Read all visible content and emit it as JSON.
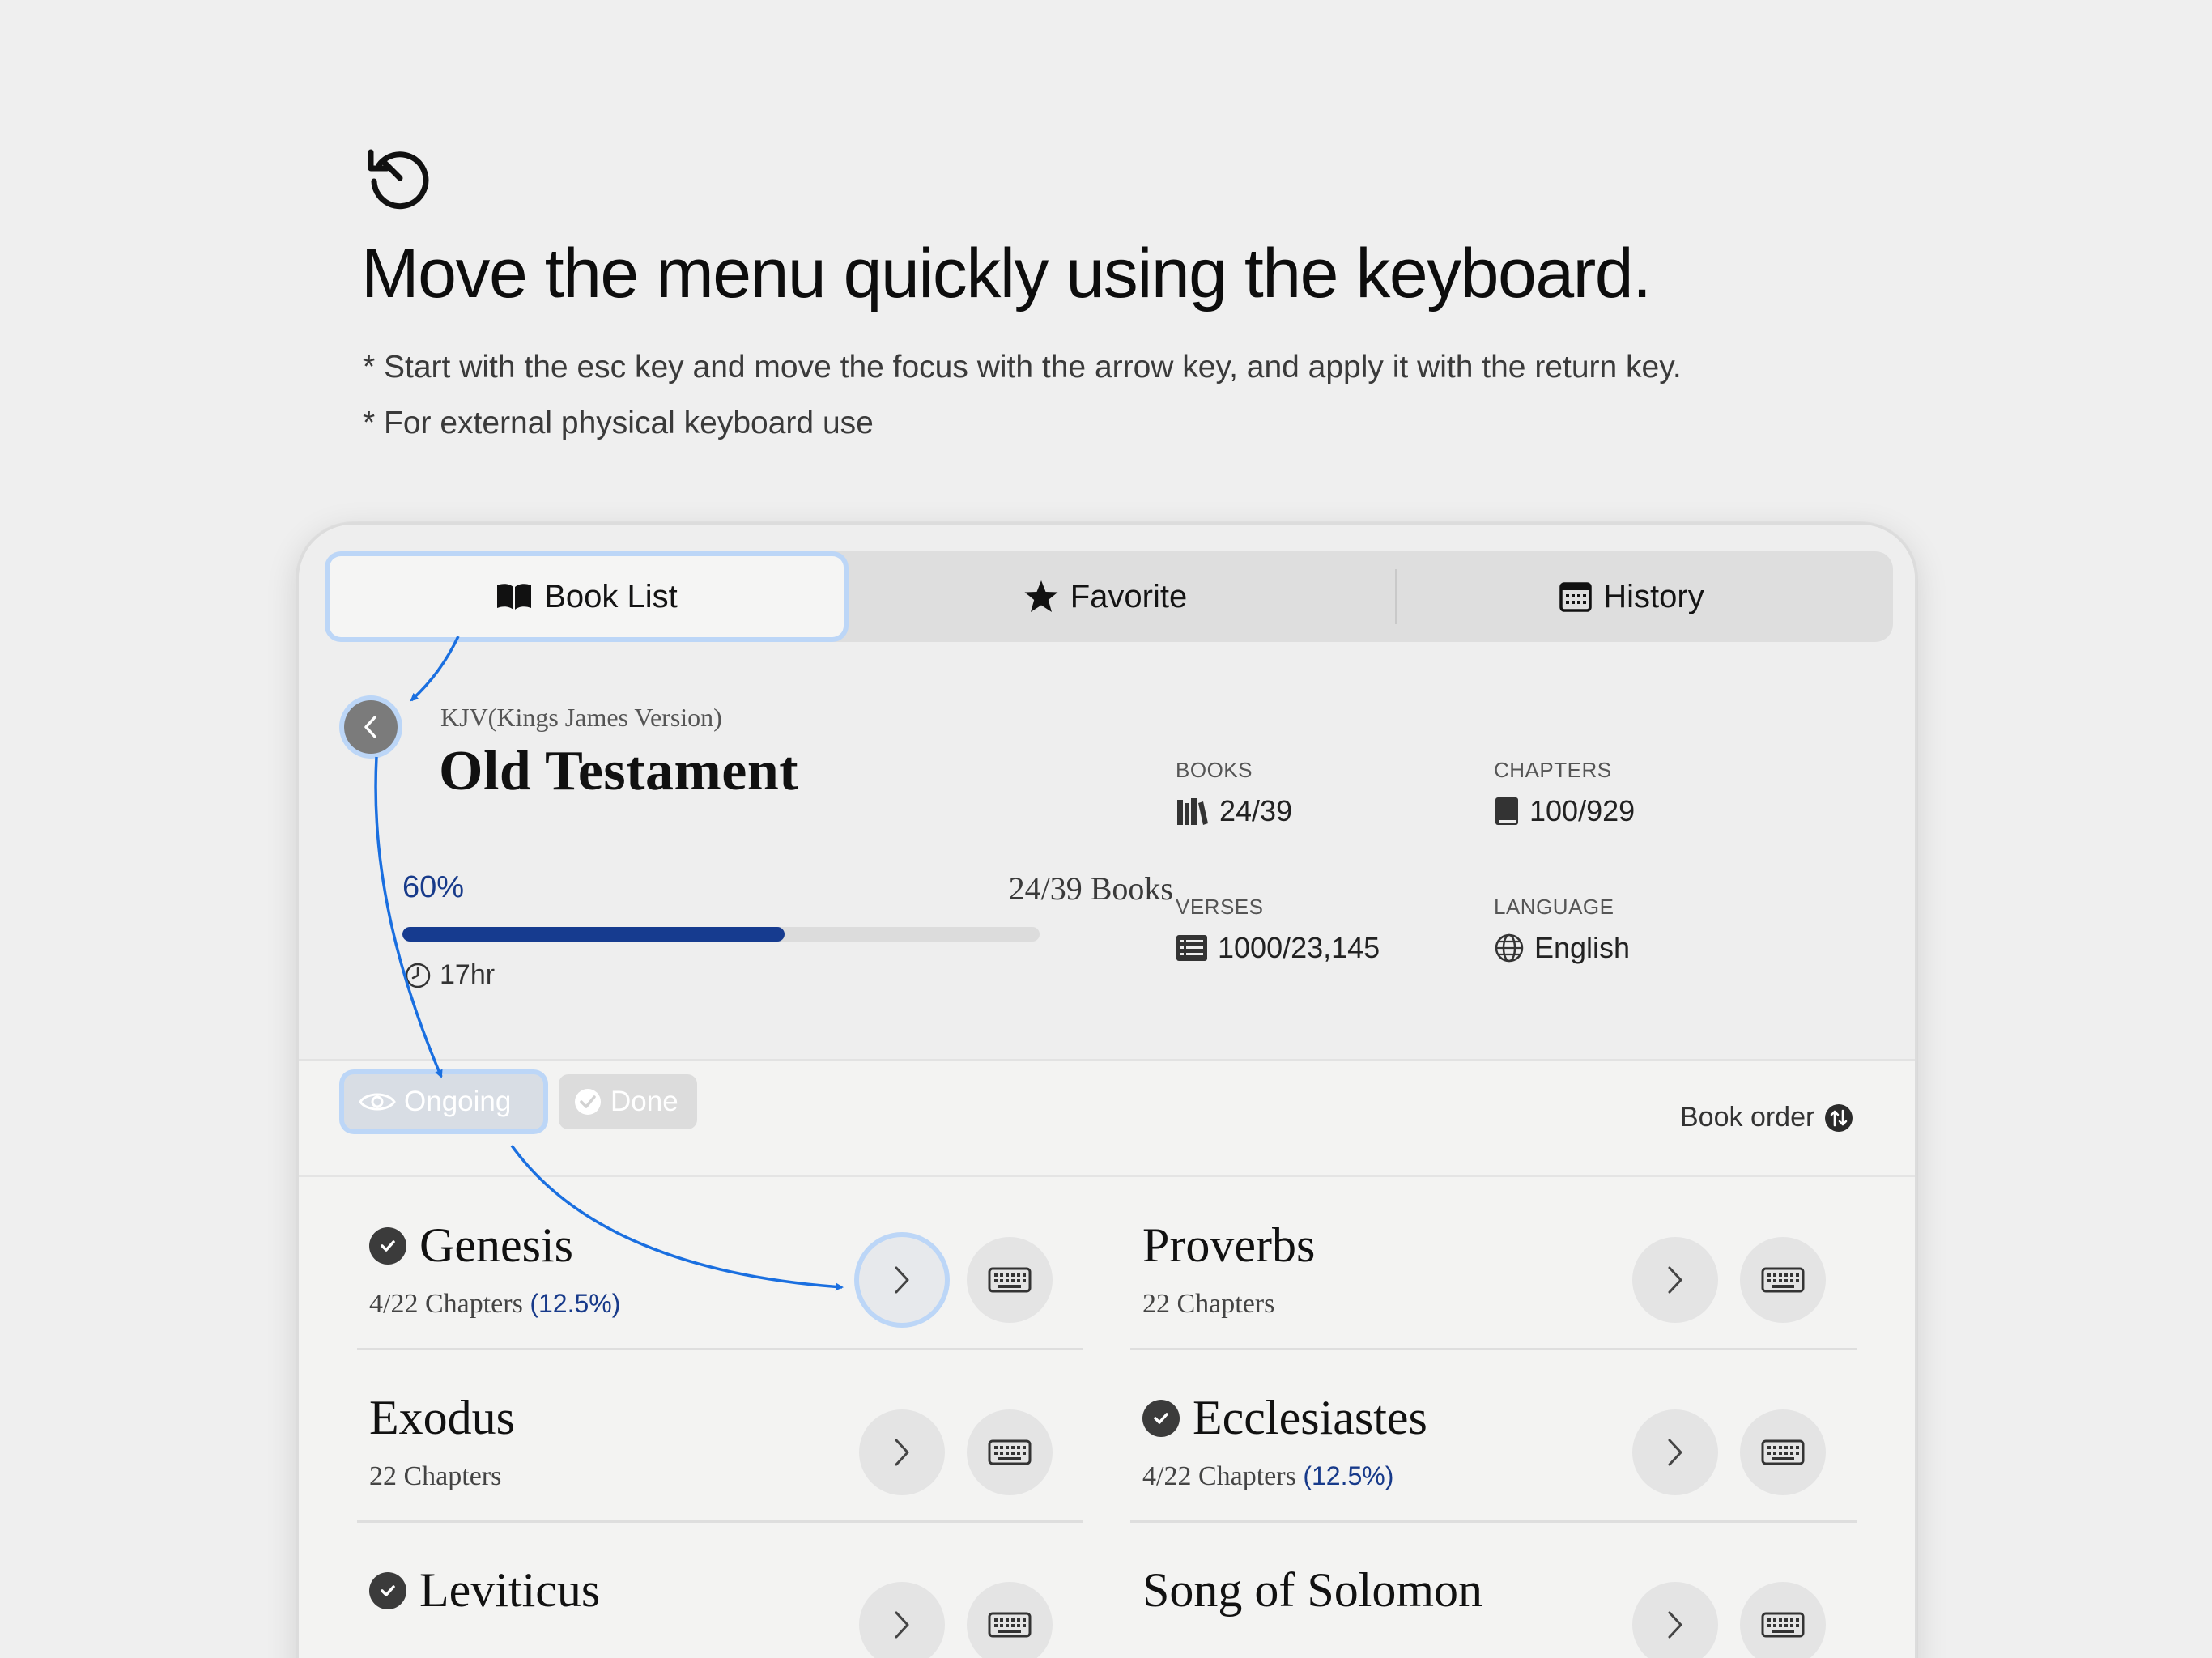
{
  "header": {
    "icon": "history-rotate-icon",
    "headline": "Move the menu quickly using the keyboard.",
    "note1": "* Start with the esc key and move the focus with the arrow key, and apply it with the return key.",
    "note2": "* For external physical keyboard use"
  },
  "tabs": [
    {
      "label": "Book List",
      "icon": "open-book-icon",
      "selected": true
    },
    {
      "label": "Favorite",
      "icon": "star-icon"
    },
    {
      "label": "History",
      "icon": "calendar-icon"
    }
  ],
  "testament": {
    "version": "KJV(Kings James Version)",
    "title": "Old Testament",
    "progress_label": "60%",
    "progress": 0.6,
    "books_progress": "24/39 Books",
    "time": "17hr"
  },
  "stats": {
    "books": {
      "label": "BOOKS",
      "value": "24/39"
    },
    "chapters": {
      "label": "CHAPTERS",
      "value": "100/929"
    },
    "verses": {
      "label": "VERSES",
      "value": "1000/23,145"
    },
    "language": {
      "label": "LANGUAGE",
      "value": "English"
    }
  },
  "filters": {
    "ongoing": "Ongoing",
    "done": "Done",
    "sort": "Book order"
  },
  "books": [
    {
      "name": "Genesis",
      "done": true,
      "chapters": "4/22 Chapters",
      "percent": "(12.5%)"
    },
    {
      "name": "Proverbs",
      "done": false,
      "chapters": "22 Chapters",
      "percent": ""
    },
    {
      "name": "Exodus",
      "done": false,
      "chapters": "22 Chapters",
      "percent": ""
    },
    {
      "name": "Ecclesiastes",
      "done": true,
      "chapters": "4/22 Chapters",
      "percent": "(12.5%)"
    },
    {
      "name": "Leviticus",
      "done": true,
      "chapters": "",
      "percent": ""
    },
    {
      "name": "Song of Solomon",
      "done": false,
      "chapters": "",
      "percent": ""
    }
  ],
  "colors": {
    "accent": "#163b8f",
    "focus_ring": "#bcd6f7",
    "arrow": "#1a6fe0"
  }
}
